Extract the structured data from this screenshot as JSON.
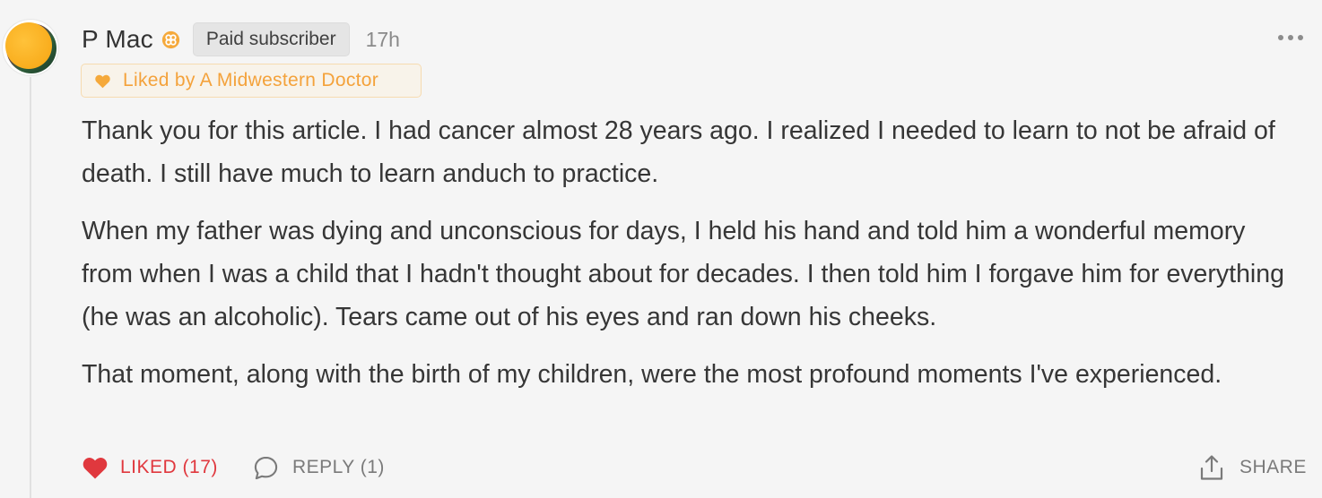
{
  "comment": {
    "author": "P Mac",
    "badge_label": "Paid subscriber",
    "timestamp": "17h",
    "liked_by": "Liked by A Midwestern Doctor",
    "paragraphs": [
      "Thank you for this article. I had cancer almost 28 years ago. I realized I needed to learn to not be afraid of death. I still have much to learn anduch to practice.",
      "When my father was dying and unconscious for days, I held his hand and told him a wonderful memory from when I was a child that I hadn't thought about for decades. I then told him I forgave him for everything (he was an alcoholic). Tears came out of his eyes and ran down his cheeks.",
      "That moment, along with the birth of my children, were the most profound moments I've experienced."
    ]
  },
  "actions": {
    "like_label": "LIKED (17)",
    "reply_label": "REPLY (1)",
    "share_label": "SHARE"
  },
  "icons": {
    "avatar": "sun-avatar",
    "subscriber_badge": "subscriber-badge-icon",
    "liked_by": "heart-icon",
    "like": "heart-icon",
    "reply": "speech-bubble-icon",
    "share": "share-icon",
    "more": "more-options-icon"
  },
  "colors": {
    "background": "#f5f5f5",
    "accent_orange": "#f4a23b",
    "liked_red": "#e0383e",
    "muted_text": "#7a7a7a",
    "body_text": "#363636"
  }
}
